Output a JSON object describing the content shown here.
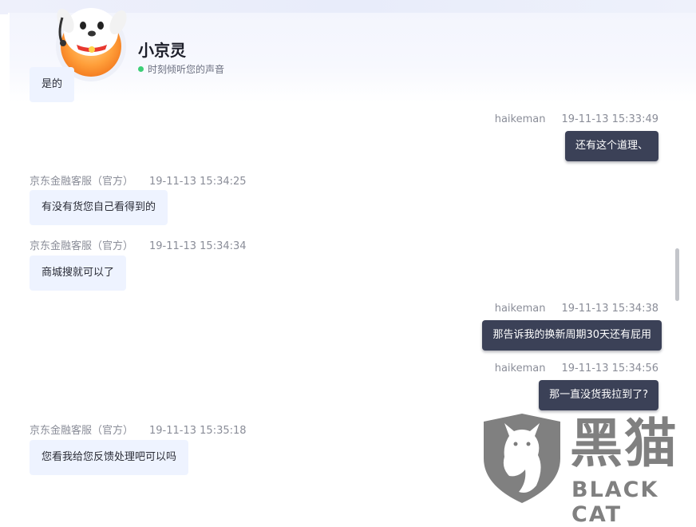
{
  "header": {
    "title": "小京灵",
    "status_text": "时刻倾听您的声音",
    "status_color": "#3ccf76"
  },
  "messages": [
    {
      "direction": "incoming",
      "text": "是的"
    },
    {
      "direction": "outgoing",
      "sender": "haikeman",
      "time": "19-11-13 15:33:49",
      "text": "还有这个道理、"
    },
    {
      "direction": "incoming",
      "sender": "京东金融客服（官方）",
      "time": "19-11-13 15:34:25",
      "text": "有没有货您自己看得到的"
    },
    {
      "direction": "incoming",
      "sender": "京东金融客服（官方）",
      "time": "19-11-13 15:34:34",
      "text": "商城搜就可以了"
    },
    {
      "direction": "outgoing",
      "sender": "haikeman",
      "time": "19-11-13 15:34:38",
      "text": "那告诉我的换新周期30天还有屁用"
    },
    {
      "direction": "outgoing",
      "sender": "haikeman",
      "time": "19-11-13 15:34:56",
      "text": "那一直没货我拉到了?"
    },
    {
      "direction": "incoming",
      "sender": "京东金融客服（官方）",
      "time": "19-11-13 15:35:18",
      "text": "您看我给您反馈处理吧可以吗"
    }
  ],
  "watermark": {
    "cn": "黑猫",
    "en": "BLACK CAT"
  },
  "colors": {
    "incoming_bubble": "#eef3ff",
    "outgoing_bubble": "#3b4157",
    "accent_red": "#e8382f"
  }
}
